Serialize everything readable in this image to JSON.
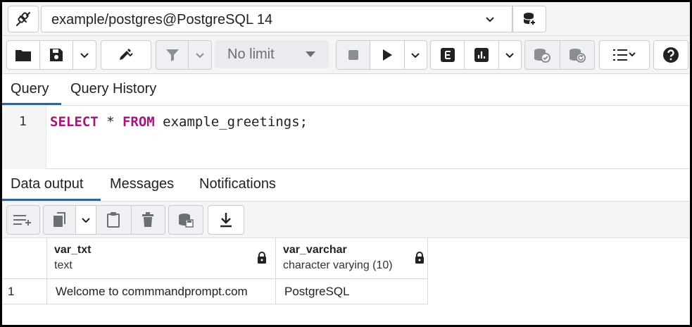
{
  "connection": {
    "name": "example/postgres@PostgreSQL 14"
  },
  "toolbar": {
    "row_limit": "No limit"
  },
  "query_tabs": [
    "Query",
    "Query History"
  ],
  "editor": {
    "line_number": "1",
    "keyword_select": "SELECT",
    "star": " * ",
    "keyword_from": "FROM",
    "rest": " example_greetings;"
  },
  "output_tabs": [
    "Data output",
    "Messages",
    "Notifications"
  ],
  "grid": {
    "columns": [
      {
        "name": "var_txt",
        "type": "text"
      },
      {
        "name": "var_varchar",
        "type": "character varying (10)"
      }
    ],
    "rows": [
      {
        "row_number": "1",
        "cells": [
          "Welcome to commmandprompt.com",
          "PostgreSQL"
        ]
      }
    ]
  },
  "colors": {
    "accent": "#326690",
    "keyword": "#a4167c"
  }
}
